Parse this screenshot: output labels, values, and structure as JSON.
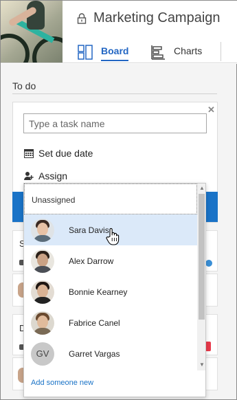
{
  "header": {
    "title": "Marketing Campaign",
    "tabs": [
      {
        "label": "Board",
        "icon": "board-icon",
        "active": true
      },
      {
        "label": "Charts",
        "icon": "charts-icon",
        "active": false
      }
    ]
  },
  "bucket": {
    "title": "To do"
  },
  "new_task": {
    "placeholder": "Type a task name",
    "due_date_label": "Set due date",
    "assign_label": "Assign"
  },
  "background_cards": {
    "card1_letter": "S",
    "card3_letter": "D"
  },
  "assign_dropdown": {
    "unassigned_label": "Unassigned",
    "people": [
      {
        "name": "Sara Davis",
        "hovered": true
      },
      {
        "name": "Alex Darrow",
        "hovered": false
      },
      {
        "name": "Bonnie Kearney",
        "hovered": false
      },
      {
        "name": "Fabrice Canel",
        "hovered": false
      },
      {
        "name": "Garret Vargas",
        "initials": "GV",
        "hovered": false
      }
    ],
    "add_someone_label": "Add someone new"
  },
  "colors": {
    "accent": "#2266c3",
    "primary_button": "#1a73c7",
    "hover_row": "#dbe9f9"
  }
}
